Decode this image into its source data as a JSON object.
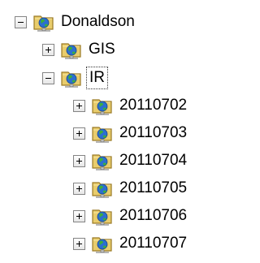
{
  "tree": {
    "root": {
      "label": "Donaldson",
      "state": "expanded"
    },
    "gis": {
      "label": "GIS",
      "state": "collapsed"
    },
    "ir": {
      "label": "IR",
      "state": "expanded"
    },
    "children": [
      {
        "label": "20110702",
        "state": "collapsed"
      },
      {
        "label": "20110703",
        "state": "collapsed"
      },
      {
        "label": "20110704",
        "state": "collapsed"
      },
      {
        "label": "20110705",
        "state": "collapsed"
      },
      {
        "label": "20110706",
        "state": "collapsed"
      },
      {
        "label": "20110707",
        "state": "collapsed"
      }
    ]
  },
  "icons": {
    "node_icon": "network-folder-icon",
    "expanded_toggle": "minus-box-icon",
    "collapsed_toggle": "plus-box-icon"
  },
  "colors": {
    "folder_fill": "#e8cc6c",
    "folder_edge": "#9a7a24",
    "globe_blue": "#2c6fd0",
    "globe_green": "#3cae3c",
    "toggle_border": "#848484"
  }
}
